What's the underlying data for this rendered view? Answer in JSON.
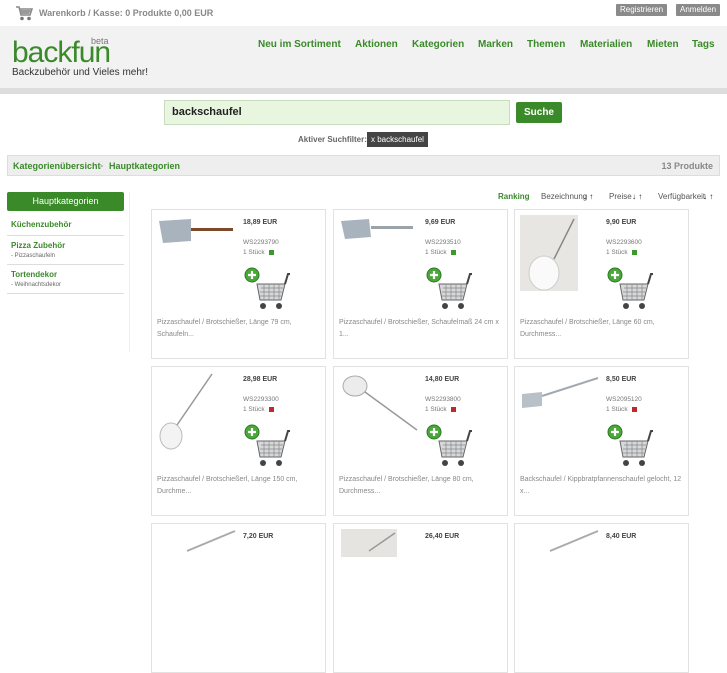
{
  "topbar": {
    "cart_text": "Warenkorb / Kasse: 0 Produkte 0,00 EUR",
    "register": "Registrieren",
    "login": "Anmelden"
  },
  "brand": {
    "logo": "backfun",
    "beta": "beta",
    "tagline": "Backzubehör und Vieles mehr!"
  },
  "nav": [
    "Neu im Sortiment",
    "Aktionen",
    "Kategorien",
    "Marken",
    "Themen",
    "Materialien",
    "Mieten",
    "Tags"
  ],
  "search": {
    "query": "backschaufel",
    "button": "Suche",
    "filter_label": "Aktiver Suchfilter:",
    "filter_chip": "x backschaufel"
  },
  "breadcrumb": {
    "root": "Kategorienübersicht",
    "sep": ">",
    "current": "Hauptkategorien",
    "count": "13 Produkte"
  },
  "sidebar": {
    "heading": "Hauptkategorien",
    "categories": [
      {
        "name": "Küchenzubehör",
        "sub": ""
      },
      {
        "name": "Pizza Zubehör",
        "sub": "- Pizzaschaufeln"
      },
      {
        "name": "Tortendekor",
        "sub": "- Weihnachtsdekor"
      }
    ]
  },
  "sort": {
    "ranking": "Ranking",
    "name": "Bezeichnung",
    "price": "Preise",
    "availability": "Verfügbarkeit"
  },
  "colors": {
    "accent": "#3a8a2a",
    "in_stock": "#3a9a2a",
    "out_of_stock": "#c0282a"
  },
  "products": [
    {
      "price": "18,89 EUR",
      "sku": "WS2293790",
      "qty": "1 Stück",
      "stock": "green",
      "desc": "Pizzaschaufel / Brotschießer, Länge 79 cm, Schaufeln...",
      "img": "peel-wood"
    },
    {
      "price": "9,69 EUR",
      "sku": "WS2293510",
      "qty": "1 Stück",
      "stock": "green",
      "desc": "Pizzaschaufel / Brotschießer, Schaufelmaß 24 cm x 1...",
      "img": "peel-metal"
    },
    {
      "price": "9,90 EUR",
      "sku": "WS2293600",
      "qty": "1 Stück",
      "stock": "green",
      "desc": "Pizzaschaufel / Brotschießer, Länge 60 cm, Durchmess...",
      "img": "peel-round-photo"
    },
    {
      "price": "28,98 EUR",
      "sku": "WS2293300",
      "qty": "1 Stück",
      "stock": "red",
      "desc": "Pizzaschaufel / Brotschießerl, Länge 150 cm, Durchme...",
      "img": "peel-round-long"
    },
    {
      "price": "14,80 EUR",
      "sku": "WS2293800",
      "qty": "1 Stück",
      "stock": "red",
      "desc": "Pizzaschaufel / Brotschießer, Länge 80 cm, Durchmess...",
      "img": "peel-round-diag"
    },
    {
      "price": "8,50 EUR",
      "sku": "WS2095120",
      "qty": "1 Stück",
      "stock": "red",
      "desc": "Backschaufel / Kippbratpfannenschaufel gelocht, 12 x...",
      "img": "flat-spatula"
    },
    {
      "price": "7,20 EUR",
      "sku": "",
      "qty": "",
      "stock": "",
      "desc": "",
      "img": "handle"
    },
    {
      "price": "26,40 EUR",
      "sku": "",
      "qty": "",
      "stock": "",
      "desc": "",
      "img": "handle2"
    },
    {
      "price": "8,40 EUR",
      "sku": "",
      "qty": "",
      "stock": "",
      "desc": "",
      "img": "handle"
    }
  ]
}
